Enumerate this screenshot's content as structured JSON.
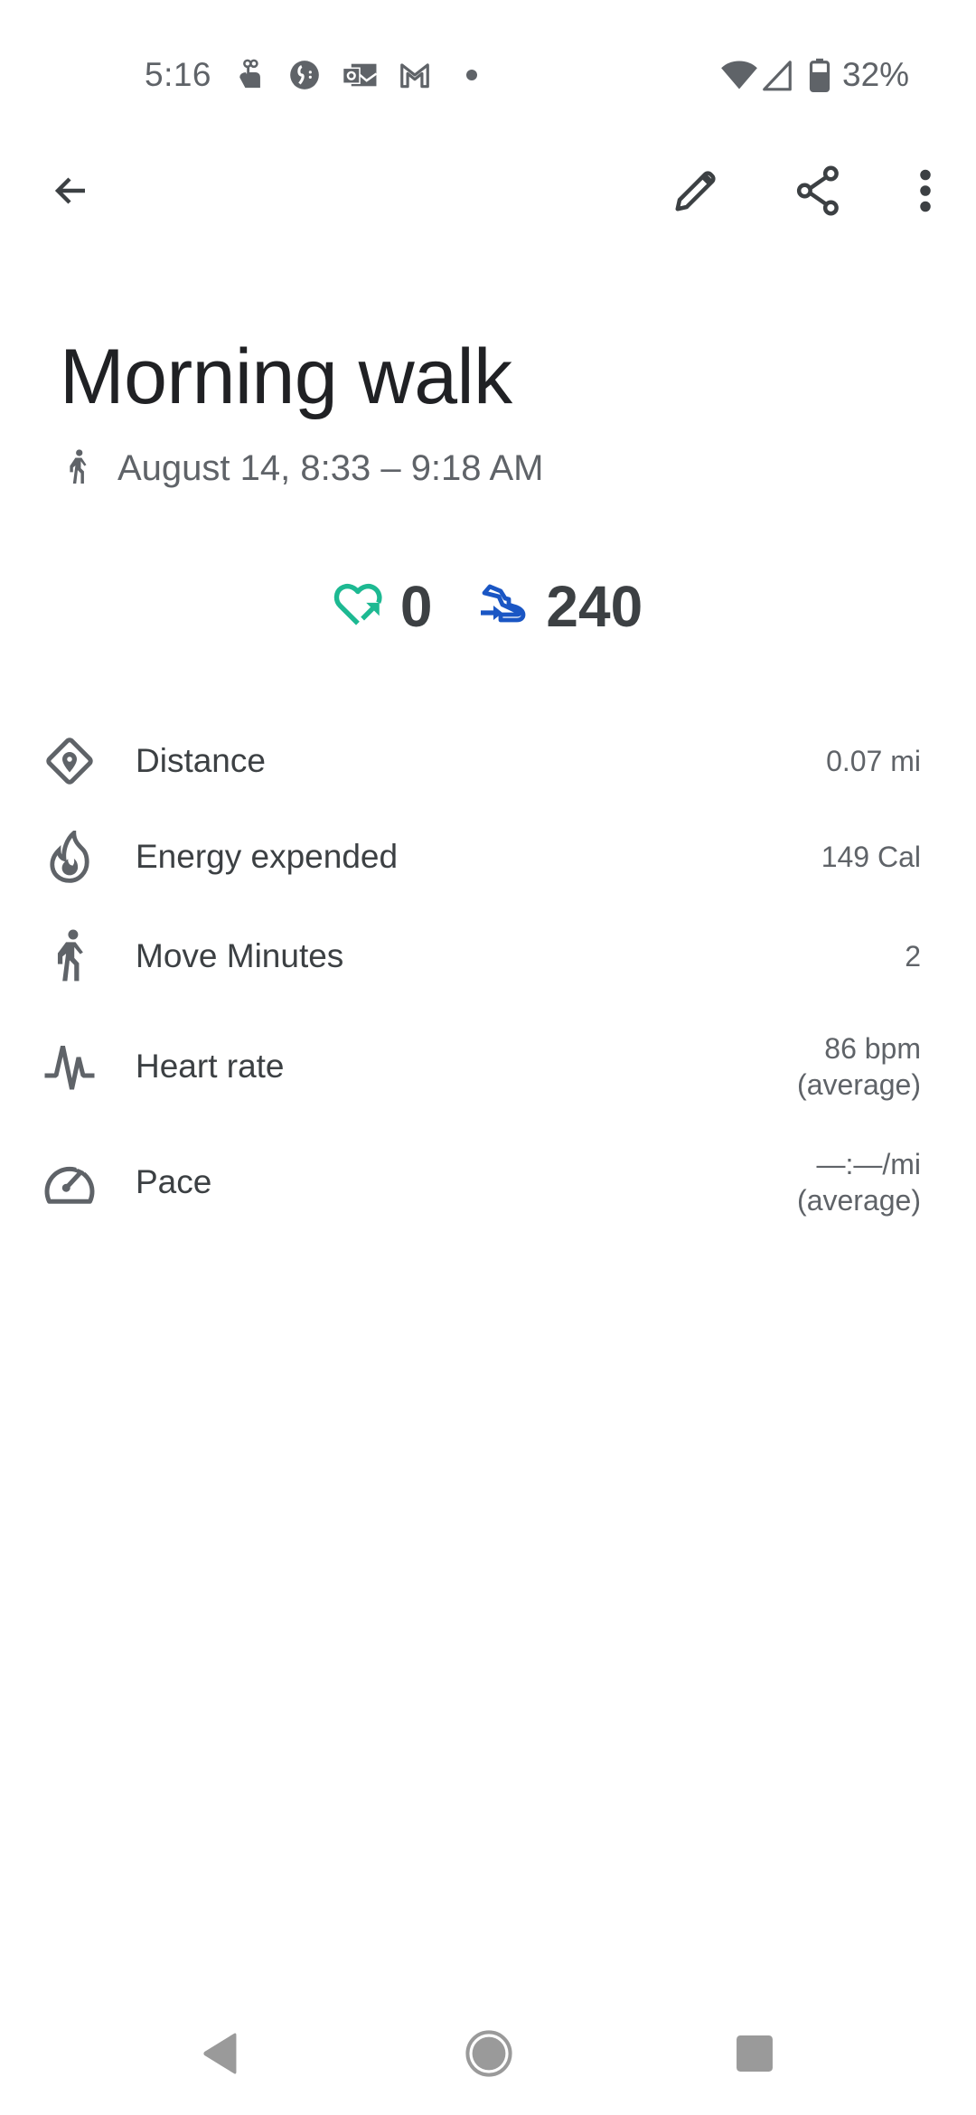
{
  "status_bar": {
    "time": "5:16",
    "notification_icons": [
      "touch-gesture-icon",
      "app-notification-icon",
      "outlook-icon",
      "gmail-icon",
      "more-notifications-dot-icon"
    ],
    "system_icons": [
      "wifi-icon",
      "cellular-signal-icon",
      "battery-icon"
    ],
    "battery_percent": "32%"
  },
  "toolbar": {
    "back": "back-arrow-icon",
    "actions": [
      "edit-icon",
      "share-icon",
      "more-vert-icon"
    ]
  },
  "activity": {
    "title": "Morning walk",
    "activity_icon": "walking-icon",
    "date_range": "August 14, 8:33 – 9:18 AM"
  },
  "goals": {
    "heart_points": {
      "icon": "heart-points-icon",
      "value": "0",
      "color": "#1db992"
    },
    "steps": {
      "icon": "steps-icon",
      "value": "240",
      "color": "#1a56c4"
    }
  },
  "metrics": [
    {
      "icon": "location-diamond-icon",
      "label": "Distance",
      "value": "0.07 mi",
      "sub": ""
    },
    {
      "icon": "flame-icon",
      "label": "Energy expended",
      "value": "149 Cal",
      "sub": ""
    },
    {
      "icon": "walking-icon",
      "label": "Move Minutes",
      "value": "2",
      "sub": ""
    },
    {
      "icon": "heart-rate-pulse-icon",
      "label": "Heart rate",
      "value": "86 bpm",
      "sub": "(average)"
    },
    {
      "icon": "speedometer-icon",
      "label": "Pace",
      "value": "—:—/mi",
      "sub": "(average)"
    }
  ],
  "nav_bar": [
    "nav-back-icon",
    "nav-home-icon",
    "nav-recents-icon"
  ]
}
